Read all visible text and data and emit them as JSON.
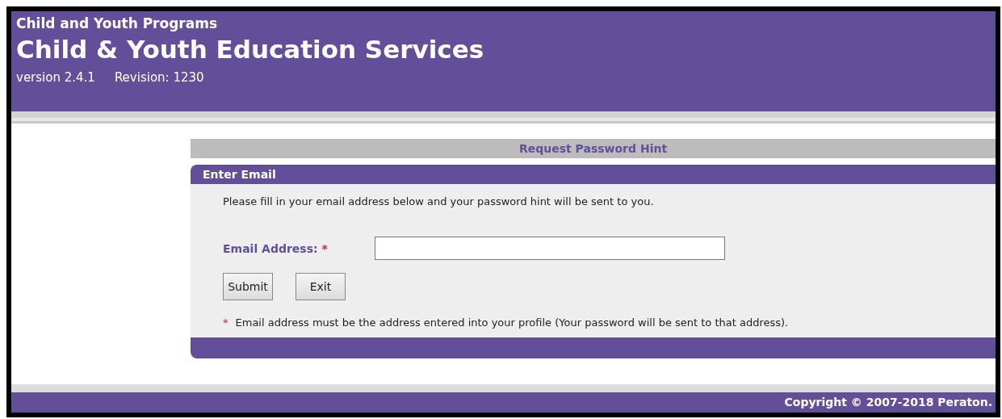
{
  "header": {
    "subtitle": "Child and Youth Programs",
    "title": "Child & Youth Education Services",
    "version": "version 2.4.1",
    "revision": "Revision: 1230"
  },
  "page_title": "Request Password Hint",
  "panel": {
    "title": "Enter Email",
    "instructions": "Please fill in your email address below and your password hint will be sent to you.",
    "field": {
      "label": "Email Address:",
      "required_mark": "*"
    },
    "buttons": [
      "Submit",
      "Exit"
    ],
    "note": {
      "mark": "*",
      "text": "Email address must be the address entered into your profile (Your password will be sent to that address)."
    }
  },
  "footer": "Copyright © 2007-2018 Peraton."
}
